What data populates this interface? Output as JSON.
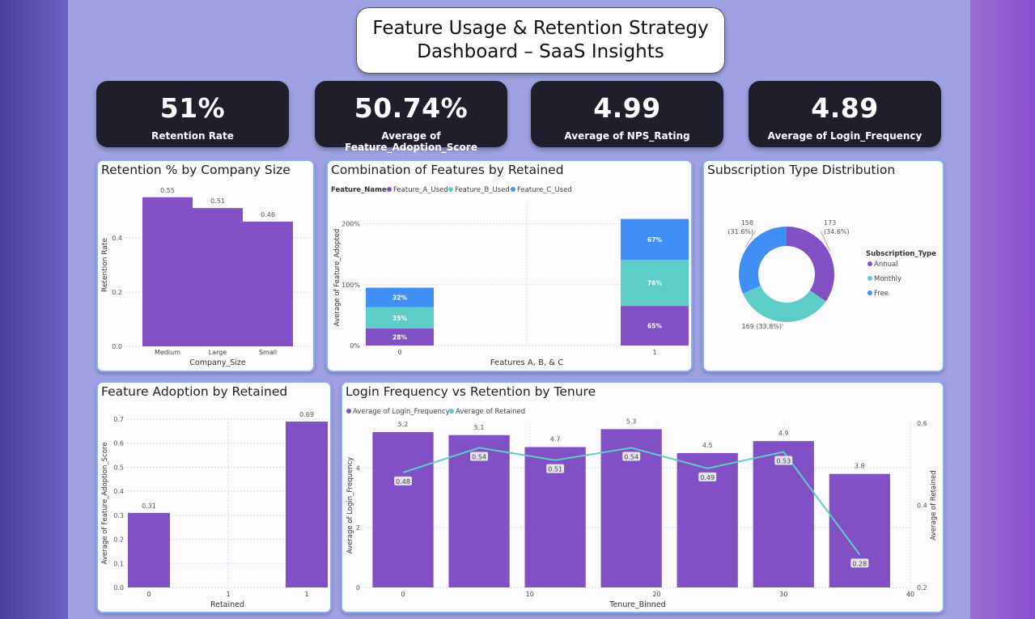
{
  "header": {
    "title_line1": "Feature Usage & Retention Strategy",
    "title_line2": "Dashboard – SaaS Insights"
  },
  "kpis": [
    {
      "value": "51%",
      "label": "Retention Rate"
    },
    {
      "value": "50.74%",
      "label": "Average of Feature_Adoption_Score"
    },
    {
      "value": "4.99",
      "label": "Average of NPS_Rating"
    },
    {
      "value": "4.89",
      "label": "Average of Login_Frequency"
    }
  ],
  "colors": {
    "purple": "#8150c4",
    "teal": "#5ecdc8",
    "blue": "#3f8ff5"
  },
  "chart_data": [
    {
      "type": "bar",
      "title": "Retention % by Company Size",
      "xlabel": "Company_Size",
      "ylabel": "Retention Rate",
      "categories": [
        "Medium",
        "Large",
        "Small"
      ],
      "values": [
        0.55,
        0.51,
        0.46
      ],
      "data_labels": [
        "0.55",
        "0.51",
        "0.46"
      ],
      "yticks": [
        "0.0",
        "0.2",
        "0.4"
      ],
      "ylim": [
        0,
        0.6
      ]
    },
    {
      "type": "bar",
      "stacked": true,
      "title": "Combination of Features by Retained",
      "xlabel": "Features A, B, & C",
      "ylabel": "Average of Feature_Adopted",
      "legend_title": "Feature_Name",
      "categories": [
        "0",
        "1"
      ],
      "x_ticks": [
        "0",
        "1"
      ],
      "yticks": [
        "0%",
        "100%",
        "200%"
      ],
      "ylim": [
        0,
        250
      ],
      "series": [
        {
          "name": "Feature_A_Used",
          "values": [
            28,
            65
          ],
          "labels": [
            "28%",
            "65%"
          ]
        },
        {
          "name": "Feature_B_Used",
          "values": [
            35,
            76
          ],
          "labels": [
            "35%",
            "76%"
          ]
        },
        {
          "name": "Feature_C_Used",
          "values": [
            32,
            67
          ],
          "labels": [
            "32%",
            "67%"
          ]
        }
      ]
    },
    {
      "type": "pie",
      "donut": true,
      "title": "Subscription Type Distribution",
      "legend_title": "Subscription_Type",
      "categories": [
        "Annual",
        "Monthly",
        "Free"
      ],
      "values": [
        173,
        169,
        158
      ],
      "labels": [
        [
          "173",
          "(34.6%)"
        ],
        [
          "169 (33.8%)"
        ],
        [
          "158",
          "(31.6%)"
        ]
      ]
    },
    {
      "type": "bar",
      "title": "Feature Adoption by Retained",
      "xlabel": "Retained",
      "ylabel": "Average of Feature_Adoption_Score",
      "x": [
        0,
        1
      ],
      "values": [
        0.31,
        0.69
      ],
      "data_labels": [
        "0.31",
        "0.69"
      ],
      "x_ticks": [
        "0",
        "1",
        "1"
      ],
      "yticks": [
        "0.0",
        "0.1",
        "0.2",
        "0.3",
        "0.4",
        "0.5",
        "0.6",
        "0.7"
      ],
      "ylim": [
        0,
        0.7
      ]
    },
    {
      "type": "bar",
      "combo": "bar+line",
      "title": "Login Frequency vs Retention by Tenure",
      "xlabel": "Tenure_Binned",
      "ylabel": "Average of Login_Frequency",
      "y2label": "Average of Retained",
      "x": [
        0,
        6,
        12,
        18,
        24,
        30,
        36
      ],
      "x_ticks": [
        "0",
        "10",
        "20",
        "30",
        "40"
      ],
      "xlim": [
        -3,
        40
      ],
      "yticks": [
        "0",
        "2",
        "4"
      ],
      "y2ticks": [
        "0.2",
        "0.4",
        "0.6"
      ],
      "ylim": [
        0,
        5.5
      ],
      "y2lim": [
        0.2,
        0.6
      ],
      "series": [
        {
          "name": "Average of Login_Frequency",
          "values": [
            5.2,
            5.1,
            4.7,
            5.3,
            4.5,
            4.9,
            3.8
          ],
          "labels": [
            "5.2",
            "5.1",
            "4.7",
            "5.3",
            "4.5",
            "4.9",
            "3.8"
          ]
        },
        {
          "name": "Average of Retained",
          "values": [
            0.48,
            0.54,
            0.51,
            0.54,
            0.49,
            0.53,
            0.28
          ],
          "labels": [
            "0.48",
            "0.54",
            "0.51",
            "0.54",
            "0.49",
            "0.53",
            "0.28"
          ]
        }
      ]
    }
  ]
}
